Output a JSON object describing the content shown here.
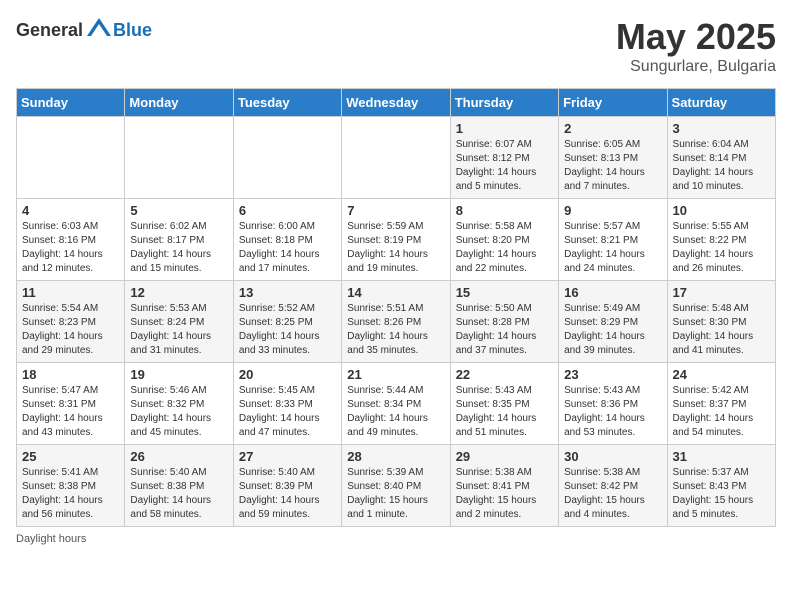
{
  "header": {
    "logo_general": "General",
    "logo_blue": "Blue",
    "month": "May 2025",
    "location": "Sungurlare, Bulgaria"
  },
  "days_of_week": [
    "Sunday",
    "Monday",
    "Tuesday",
    "Wednesday",
    "Thursday",
    "Friday",
    "Saturday"
  ],
  "weeks": [
    [
      {
        "day": "",
        "info": ""
      },
      {
        "day": "",
        "info": ""
      },
      {
        "day": "",
        "info": ""
      },
      {
        "day": "",
        "info": ""
      },
      {
        "day": "1",
        "info": "Sunrise: 6:07 AM\nSunset: 8:12 PM\nDaylight: 14 hours\nand 5 minutes."
      },
      {
        "day": "2",
        "info": "Sunrise: 6:05 AM\nSunset: 8:13 PM\nDaylight: 14 hours\nand 7 minutes."
      },
      {
        "day": "3",
        "info": "Sunrise: 6:04 AM\nSunset: 8:14 PM\nDaylight: 14 hours\nand 10 minutes."
      }
    ],
    [
      {
        "day": "4",
        "info": "Sunrise: 6:03 AM\nSunset: 8:16 PM\nDaylight: 14 hours\nand 12 minutes."
      },
      {
        "day": "5",
        "info": "Sunrise: 6:02 AM\nSunset: 8:17 PM\nDaylight: 14 hours\nand 15 minutes."
      },
      {
        "day": "6",
        "info": "Sunrise: 6:00 AM\nSunset: 8:18 PM\nDaylight: 14 hours\nand 17 minutes."
      },
      {
        "day": "7",
        "info": "Sunrise: 5:59 AM\nSunset: 8:19 PM\nDaylight: 14 hours\nand 19 minutes."
      },
      {
        "day": "8",
        "info": "Sunrise: 5:58 AM\nSunset: 8:20 PM\nDaylight: 14 hours\nand 22 minutes."
      },
      {
        "day": "9",
        "info": "Sunrise: 5:57 AM\nSunset: 8:21 PM\nDaylight: 14 hours\nand 24 minutes."
      },
      {
        "day": "10",
        "info": "Sunrise: 5:55 AM\nSunset: 8:22 PM\nDaylight: 14 hours\nand 26 minutes."
      }
    ],
    [
      {
        "day": "11",
        "info": "Sunrise: 5:54 AM\nSunset: 8:23 PM\nDaylight: 14 hours\nand 29 minutes."
      },
      {
        "day": "12",
        "info": "Sunrise: 5:53 AM\nSunset: 8:24 PM\nDaylight: 14 hours\nand 31 minutes."
      },
      {
        "day": "13",
        "info": "Sunrise: 5:52 AM\nSunset: 8:25 PM\nDaylight: 14 hours\nand 33 minutes."
      },
      {
        "day": "14",
        "info": "Sunrise: 5:51 AM\nSunset: 8:26 PM\nDaylight: 14 hours\nand 35 minutes."
      },
      {
        "day": "15",
        "info": "Sunrise: 5:50 AM\nSunset: 8:28 PM\nDaylight: 14 hours\nand 37 minutes."
      },
      {
        "day": "16",
        "info": "Sunrise: 5:49 AM\nSunset: 8:29 PM\nDaylight: 14 hours\nand 39 minutes."
      },
      {
        "day": "17",
        "info": "Sunrise: 5:48 AM\nSunset: 8:30 PM\nDaylight: 14 hours\nand 41 minutes."
      }
    ],
    [
      {
        "day": "18",
        "info": "Sunrise: 5:47 AM\nSunset: 8:31 PM\nDaylight: 14 hours\nand 43 minutes."
      },
      {
        "day": "19",
        "info": "Sunrise: 5:46 AM\nSunset: 8:32 PM\nDaylight: 14 hours\nand 45 minutes."
      },
      {
        "day": "20",
        "info": "Sunrise: 5:45 AM\nSunset: 8:33 PM\nDaylight: 14 hours\nand 47 minutes."
      },
      {
        "day": "21",
        "info": "Sunrise: 5:44 AM\nSunset: 8:34 PM\nDaylight: 14 hours\nand 49 minutes."
      },
      {
        "day": "22",
        "info": "Sunrise: 5:43 AM\nSunset: 8:35 PM\nDaylight: 14 hours\nand 51 minutes."
      },
      {
        "day": "23",
        "info": "Sunrise: 5:43 AM\nSunset: 8:36 PM\nDaylight: 14 hours\nand 53 minutes."
      },
      {
        "day": "24",
        "info": "Sunrise: 5:42 AM\nSunset: 8:37 PM\nDaylight: 14 hours\nand 54 minutes."
      }
    ],
    [
      {
        "day": "25",
        "info": "Sunrise: 5:41 AM\nSunset: 8:38 PM\nDaylight: 14 hours\nand 56 minutes."
      },
      {
        "day": "26",
        "info": "Sunrise: 5:40 AM\nSunset: 8:38 PM\nDaylight: 14 hours\nand 58 minutes."
      },
      {
        "day": "27",
        "info": "Sunrise: 5:40 AM\nSunset: 8:39 PM\nDaylight: 14 hours\nand 59 minutes."
      },
      {
        "day": "28",
        "info": "Sunrise: 5:39 AM\nSunset: 8:40 PM\nDaylight: 15 hours\nand 1 minute."
      },
      {
        "day": "29",
        "info": "Sunrise: 5:38 AM\nSunset: 8:41 PM\nDaylight: 15 hours\nand 2 minutes."
      },
      {
        "day": "30",
        "info": "Sunrise: 5:38 AM\nSunset: 8:42 PM\nDaylight: 15 hours\nand 4 minutes."
      },
      {
        "day": "31",
        "info": "Sunrise: 5:37 AM\nSunset: 8:43 PM\nDaylight: 15 hours\nand 5 minutes."
      }
    ]
  ],
  "footer": {
    "note": "Daylight hours"
  }
}
